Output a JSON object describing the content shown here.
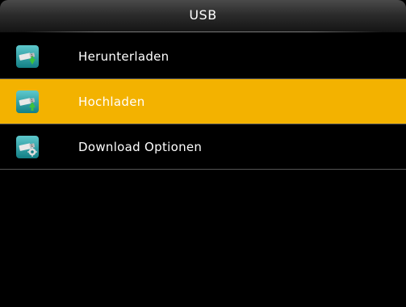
{
  "header": {
    "title": "USB"
  },
  "menu": {
    "items": [
      {
        "label": "Herunterladen",
        "icon": "usb-download-icon",
        "selected": false
      },
      {
        "label": "Hochladen",
        "icon": "usb-upload-icon",
        "selected": true
      },
      {
        "label": "Download Optionen",
        "icon": "usb-settings-icon",
        "selected": false
      }
    ]
  },
  "colors": {
    "background": "#000000",
    "highlight": "#f3b200",
    "text": "#ffffff",
    "icon_teal": "#1a9aa0",
    "icon_green": "#3cc23c"
  }
}
